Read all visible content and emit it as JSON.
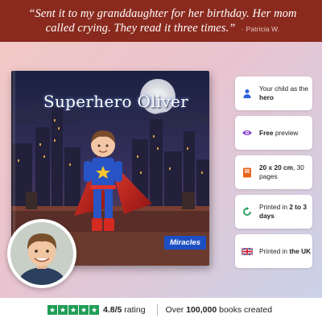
{
  "quote": {
    "text": "“Sent it to my granddaughter for her birthday. Her mom called crying. They read it three times.”",
    "author": "· Patricia W."
  },
  "book": {
    "title": "Superhero Oliver",
    "publisher": "Miracles"
  },
  "features": [
    {
      "icon": "person-icon",
      "color": "#2f63e0",
      "pre": "Your child as the ",
      "bold": "hero",
      "post": ""
    },
    {
      "icon": "eye-icon",
      "color": "#8a3fd1",
      "pre": "",
      "bold": "Free",
      "post": " preview"
    },
    {
      "icon": "book-icon",
      "color": "#e8641e",
      "pre": "",
      "bold": "20 x 20 cm",
      "post": ", 30 pages"
    },
    {
      "icon": "refresh-icon",
      "color": "#1f9d55",
      "pre": "Printed in ",
      "bold": "2 to 3 days",
      "post": ""
    },
    {
      "icon": "uk-flag-icon",
      "color": "#cf142b",
      "pre": "Printed in ",
      "bold": "the UK",
      "post": ""
    }
  ],
  "footer": {
    "stars": 5,
    "rating_value": "4.8/5",
    "rating_label": " rating",
    "customers_pre": "Over ",
    "customers_bold": "100,000",
    "customers_post": " books created",
    "star_color": "#1f9d55"
  }
}
